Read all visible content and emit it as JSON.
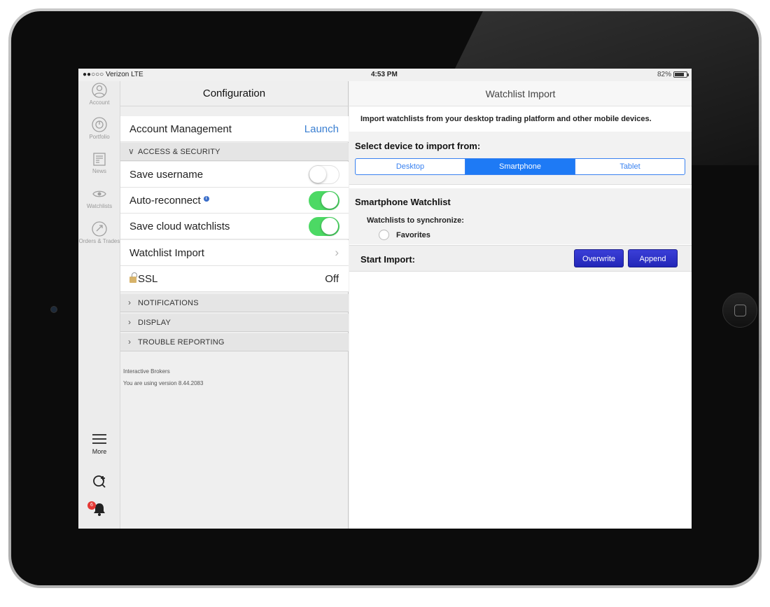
{
  "status_bar": {
    "carrier": "●●○○○ Verizon  LTE",
    "time": "4:53 PM",
    "battery": "82%",
    "battery_level": 0.82
  },
  "tabs": [
    {
      "label": "Account",
      "icon": "account-icon"
    },
    {
      "label": "Portfolio",
      "icon": "portfolio-icon"
    },
    {
      "label": "News",
      "icon": "news-icon"
    },
    {
      "label": "Watchlists",
      "icon": "eye-icon"
    },
    {
      "label": "Orders & Trades",
      "icon": "orders-icon"
    }
  ],
  "bottom_tabs": {
    "more_label": "More",
    "badge_count": "6"
  },
  "config": {
    "title": "Configuration",
    "account_management": {
      "label": "Account Management",
      "action": "Launch"
    },
    "access_security": "ACCESS & SECURITY",
    "save_username": {
      "label": "Save username",
      "on": false
    },
    "auto_reconnect": {
      "label": "Auto-reconnect",
      "on": true
    },
    "save_cloud": {
      "label": "Save cloud watchlists",
      "on": true
    },
    "watchlist_import": "Watchlist Import",
    "ssl": {
      "label": "SSL",
      "value": "Off"
    },
    "notifications": "NOTIFICATIONS",
    "display": "DISPLAY",
    "trouble": "TROUBLE REPORTING",
    "footer_company": "Interactive Brokers",
    "footer_version": "You are using version 8.44.2083"
  },
  "import": {
    "title": "Watchlist Import",
    "intro": "Import watchlists from your desktop trading platform and other mobile devices.",
    "select_device": "Select device to import from:",
    "devices": [
      "Desktop",
      "Smartphone",
      "Tablet"
    ],
    "selected_device": "Smartphone",
    "watchlist_title": "Smartphone Watchlist",
    "sync_label": "Watchlists to synchronize:",
    "favorites": "Favorites",
    "start_label": "Start Import:",
    "overwrite": "Overwrite",
    "append": "Append"
  }
}
